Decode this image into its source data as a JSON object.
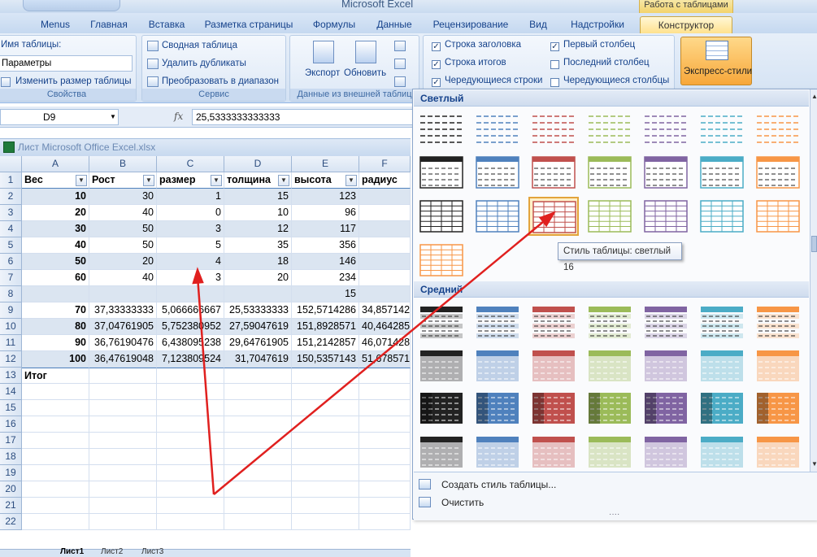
{
  "window": {
    "app_title": "Microsoft Excel",
    "context_title": "Работа с таблицами"
  },
  "tabs": [
    "Menus",
    "Главная",
    "Вставка",
    "Разметка страницы",
    "Формулы",
    "Данные",
    "Рецензирование",
    "Вид",
    "Надстройки",
    "Конструктор"
  ],
  "ribbon": {
    "props": {
      "name_label": "Имя таблицы:",
      "name_value": "Параметры",
      "resize": "Изменить размер таблицы",
      "label": "Свойства"
    },
    "service": {
      "pivot": "Сводная таблица",
      "dedupe": "Удалить дубликаты",
      "convert": "Преобразовать в диапазон",
      "label": "Сервис"
    },
    "external": {
      "export": "Экспорт",
      "refresh": "Обновить",
      "label": "Данные из внешней таблиц"
    },
    "options": [
      {
        "label": "Строка заголовка",
        "checked": true
      },
      {
        "label": "Строка итогов",
        "checked": true
      },
      {
        "label": "Чередующиеся строки",
        "checked": true
      },
      {
        "label": "Первый столбец",
        "checked": true
      },
      {
        "label": "Последний столбец",
        "checked": false
      },
      {
        "label": "Чередующиеся столбцы",
        "checked": false
      }
    ],
    "express_styles": "Экспресс-стили"
  },
  "formula_bar": {
    "name_box": "D9",
    "fx": "fx",
    "value": "25,5333333333333"
  },
  "workbook": {
    "title": "Лист Microsoft Office Excel.xlsx"
  },
  "columns": [
    "A",
    "B",
    "C",
    "D",
    "E",
    "F"
  ],
  "header_row": [
    "Вес",
    "Рост",
    "размер",
    "толщина",
    "высота",
    "радиус"
  ],
  "rows": [
    [
      "10",
      "30",
      "1",
      "15",
      "123",
      ""
    ],
    [
      "20",
      "40",
      "0",
      "10",
      "96",
      ""
    ],
    [
      "30",
      "50",
      "3",
      "12",
      "117",
      ""
    ],
    [
      "40",
      "50",
      "5",
      "35",
      "356",
      ""
    ],
    [
      "50",
      "20",
      "4",
      "18",
      "146",
      ""
    ],
    [
      "60",
      "40",
      "3",
      "20",
      "234",
      ""
    ],
    [
      "",
      "",
      "",
      "",
      "15",
      ""
    ],
    [
      "70",
      "37,33333333",
      "5,066666667",
      "25,53333333",
      "152,5714286",
      "34,857142"
    ],
    [
      "80",
      "37,04761905",
      "5,752380952",
      "27,59047619",
      "151,8928571",
      "40,464285"
    ],
    [
      "90",
      "36,76190476",
      "6,438095238",
      "29,64761905",
      "151,2142857",
      "46,071428"
    ],
    [
      "100",
      "36,47619048",
      "7,123809524",
      "31,7047619",
      "150,5357143",
      "51,678571"
    ],
    [
      "Итог",
      "",
      "",
      "",
      "",
      ""
    ]
  ],
  "row_numbers": [
    "1",
    "2",
    "3",
    "4",
    "5",
    "6",
    "7",
    "8",
    "9",
    "10",
    "11",
    "12",
    "13",
    "14",
    "15",
    "16",
    "17",
    "18",
    "19",
    "20",
    "21",
    "22"
  ],
  "sheet_tabs": [
    "Лист1",
    "Лист2",
    "Лист3"
  ],
  "gallery": {
    "light_label": "Светлый",
    "medium_label": "Средний",
    "tooltip": "Стиль таблицы: светлый 16",
    "create_style": "Создать стиль таблицы...",
    "clear": "Очистить",
    "palette": [
      "#222222",
      "#4f81bd",
      "#c0504d",
      "#9bbb59",
      "#8064a2",
      "#4bacc6",
      "#f79646"
    ]
  }
}
